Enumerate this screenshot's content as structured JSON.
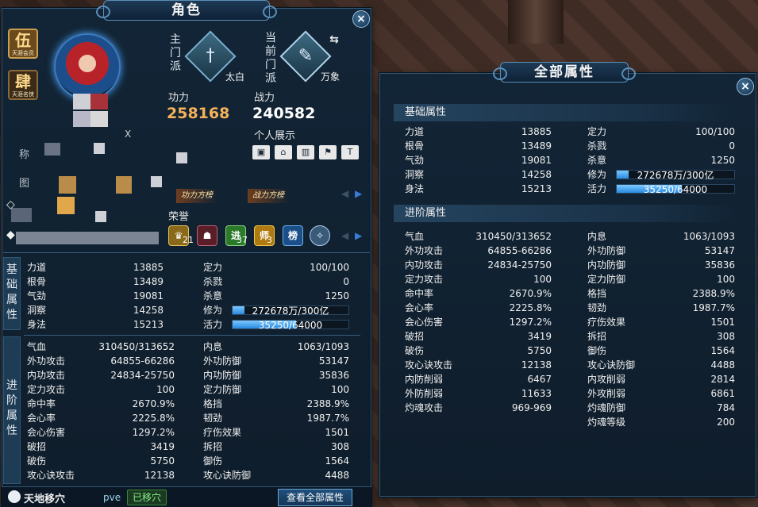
{
  "character_window": {
    "title": "角色",
    "close_icon": "×",
    "rank_seal": {
      "glyph": "伍",
      "sub": "天涯会员"
    },
    "second_seal": {
      "glyph": "肆",
      "sub": "天涯名侠"
    },
    "main_faction_label": [
      "主",
      "门",
      "派"
    ],
    "main_faction_name": "太白",
    "current_faction_label": [
      "当",
      "前",
      "门",
      "派"
    ],
    "current_faction_name": "万象",
    "power_label": "功力",
    "power_value": "258168",
    "combat_label": "战力",
    "combat_value": "240582",
    "personal_display_label": "个人展示",
    "name_label": "称",
    "map_label": "图",
    "level_prefix": "X",
    "power_rank_badge": "功力方榜",
    "combat_rank_badge": "战力方榜",
    "honor_label": "荣誉",
    "honors": [
      {
        "icon": "crown-icon",
        "count": "21"
      },
      {
        "icon": "helmet-icon",
        "count": ""
      },
      {
        "icon": "jin-badge-icon",
        "text": "进",
        "count": "37"
      },
      {
        "icon": "shi-badge-icon",
        "text": "师",
        "count": "3"
      },
      {
        "icon": "bang-badge-icon",
        "text": "榜",
        "count": ""
      },
      {
        "icon": "compass-icon",
        "count": ""
      }
    ],
    "basic_tab": [
      "基",
      "础",
      "属",
      "性"
    ],
    "advanced_tab": [
      "进",
      "阶",
      "属",
      "性"
    ],
    "basic_left": [
      {
        "k": "力道",
        "v": "13885"
      },
      {
        "k": "根骨",
        "v": "13489"
      },
      {
        "k": "气劲",
        "v": "19081"
      },
      {
        "k": "洞察",
        "v": "14258"
      },
      {
        "k": "身法",
        "v": "15213"
      }
    ],
    "basic_right": [
      {
        "k": "定力",
        "v": "100/100"
      },
      {
        "k": "杀戮",
        "v": "0"
      },
      {
        "k": "杀意",
        "v": "1250"
      }
    ],
    "cultivation": {
      "k": "修为",
      "text": "272678万/300亿",
      "fraction": 0.009
    },
    "vitality": {
      "k": "活力",
      "text": "35250/64000",
      "fraction": 0.551
    },
    "advanced_left": [
      {
        "k": "气血",
        "v": "310450/313652"
      },
      {
        "k": "外功攻击",
        "v": "64855-66286"
      },
      {
        "k": "内功攻击",
        "v": "24834-25750"
      },
      {
        "k": "定力攻击",
        "v": "100"
      },
      {
        "k": "命中率",
        "v": "2670.9%"
      },
      {
        "k": "会心率",
        "v": "2225.8%"
      },
      {
        "k": "会心伤害",
        "v": "1297.2%"
      },
      {
        "k": "破招",
        "v": "3419"
      },
      {
        "k": "破伤",
        "v": "5750"
      },
      {
        "k": "攻心诀攻击",
        "v": "12138"
      }
    ],
    "advanced_right": [
      {
        "k": "内息",
        "v": "1063/1093"
      },
      {
        "k": "外功防御",
        "v": "53147"
      },
      {
        "k": "内功防御",
        "v": "35836"
      },
      {
        "k": "定力防御",
        "v": "100"
      },
      {
        "k": "格挡",
        "v": "2388.9%"
      },
      {
        "k": "韧劲",
        "v": "1987.7%"
      },
      {
        "k": "疗伤效果",
        "v": "1501"
      },
      {
        "k": "拆招",
        "v": "308"
      },
      {
        "k": "御伤",
        "v": "1564"
      },
      {
        "k": "攻心诀防御",
        "v": "4488"
      }
    ],
    "footer_skill": "天地移穴",
    "footer_mode": "pve",
    "footer_status": "已移穴",
    "view_all_button": "查看全部属性"
  },
  "all_attributes_window": {
    "title": "全部属性",
    "close_icon": "×",
    "basic_header": "基础属性",
    "advanced_header": "进阶属性",
    "basic_left": [
      {
        "k": "力道",
        "v": "13885"
      },
      {
        "k": "根骨",
        "v": "13489"
      },
      {
        "k": "气劲",
        "v": "19081"
      },
      {
        "k": "洞察",
        "v": "14258"
      },
      {
        "k": "身法",
        "v": "15213"
      }
    ],
    "basic_right": [
      {
        "k": "定力",
        "v": "100/100"
      },
      {
        "k": "杀戮",
        "v": "0"
      },
      {
        "k": "杀意",
        "v": "1250"
      }
    ],
    "cultivation": {
      "k": "修为",
      "text": "272678万/300亿",
      "fraction": 0.009
    },
    "vitality": {
      "k": "活力",
      "text": "35250/64000",
      "fraction": 0.551
    },
    "advanced_left": [
      {
        "k": "气血",
        "v": "310450/313652"
      },
      {
        "k": "外功攻击",
        "v": "64855-66286"
      },
      {
        "k": "内功攻击",
        "v": "24834-25750"
      },
      {
        "k": "定力攻击",
        "v": "100"
      },
      {
        "k": "命中率",
        "v": "2670.9%"
      },
      {
        "k": "会心率",
        "v": "2225.8%"
      },
      {
        "k": "会心伤害",
        "v": "1297.2%"
      },
      {
        "k": "破招",
        "v": "3419"
      },
      {
        "k": "破伤",
        "v": "5750"
      },
      {
        "k": "攻心诀攻击",
        "v": "12138"
      },
      {
        "k": "内防削弱",
        "v": "6467"
      },
      {
        "k": "外防削弱",
        "v": "11633"
      },
      {
        "k": "灼魂攻击",
        "v": "969-969"
      }
    ],
    "advanced_right": [
      {
        "k": "内息",
        "v": "1063/1093"
      },
      {
        "k": "外功防御",
        "v": "53147"
      },
      {
        "k": "内功防御",
        "v": "35836"
      },
      {
        "k": "定力防御",
        "v": "100"
      },
      {
        "k": "格挡",
        "v": "2388.9%"
      },
      {
        "k": "韧劲",
        "v": "1987.7%"
      },
      {
        "k": "疗伤效果",
        "v": "1501"
      },
      {
        "k": "拆招",
        "v": "308"
      },
      {
        "k": "御伤",
        "v": "1564"
      },
      {
        "k": "攻心诀防御",
        "v": "4488"
      },
      {
        "k": "内攻削弱",
        "v": "2814"
      },
      {
        "k": "外攻削弱",
        "v": "6861"
      },
      {
        "k": "灼魂防御",
        "v": "784"
      },
      {
        "k": "灼魂等级",
        "v": "200"
      }
    ]
  },
  "colors": {
    "power_value": "#f5b25a",
    "combat_value": "#ffffff",
    "bar_fill": "#3aa2f0",
    "panel_border": "#2f5878"
  }
}
